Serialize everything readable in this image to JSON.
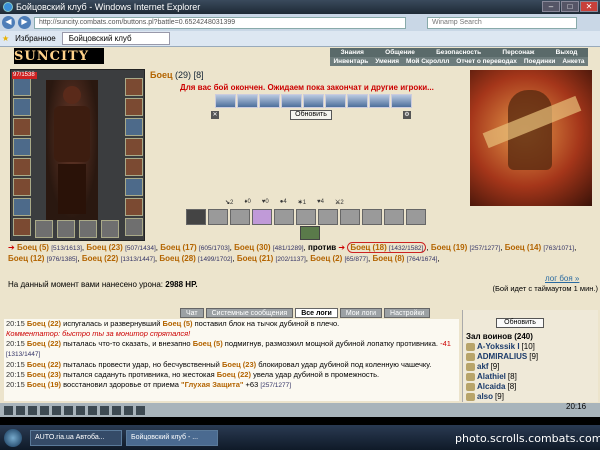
{
  "window": {
    "title": "Бойцовский клуб - Windows Internet Explorer"
  },
  "address": {
    "url": "http://suncity.combats.com/buttons.pl?battle=0.6524248031399",
    "search_placeholder": "Winamp Search"
  },
  "favorites": {
    "label": "Избранное",
    "tab": "Бойцовский клуб"
  },
  "site": {
    "logo": "SUNCITY"
  },
  "menu": {
    "row1": [
      "Знания",
      "Общение",
      "Безопасность",
      "Персонаж",
      "Выход"
    ],
    "row2": [
      "Инвентарь",
      "Умения",
      "Мой Скроллл",
      "Отчет о переводах",
      "Поединки",
      "Анкета"
    ]
  },
  "char": {
    "hp": "97/1538",
    "title_name": "Боец",
    "title_level": "(29)",
    "title_id": "[8]"
  },
  "battle": {
    "wait_msg": "Для вас бой окончен. Ожидаем пока закончат и другие игроки...",
    "refresh": "Обновить"
  },
  "stats": [
    "2",
    "0",
    "0",
    "4",
    "1",
    "4",
    "2"
  ],
  "fight": {
    "line1": [
      {
        "n": "Боец (5)",
        "s": "[513/1613]"
      },
      {
        "n": "Боец (23)",
        "s": "[507/1434]"
      },
      {
        "n": "Боец (17)",
        "s": "[605/1703]"
      },
      {
        "n": "Боец (30)",
        "s": "[481/1289]"
      }
    ],
    "vs": "против",
    "right": [
      {
        "n": "Боец (18)",
        "s": "[1432/1582]"
      },
      {
        "n": "Боец (19)",
        "s": "[257/1277]"
      },
      {
        "n": "Боец (14)",
        "s": "[763/1071]"
      },
      {
        "n": "Боец (12)",
        "s": "[976/1385]"
      },
      {
        "n": "Боец (22)",
        "s": "[1313/1447]"
      },
      {
        "n": "Боец (28)",
        "s": "[1499/1702]"
      },
      {
        "n": "Боец (21)",
        "s": "[202/1137]"
      },
      {
        "n": "Боец (2)",
        "s": "[65/877]"
      },
      {
        "n": "Боец (8)",
        "s": "[764/1674]"
      }
    ],
    "damage_label": "На данный момент вами нанесено урона:",
    "damage_value": "2988 HP.",
    "log": "лог боя »",
    "timeout": "(Бой идет с таймаутом 1 мин.)"
  },
  "tabs": [
    "Чат",
    "Системные сообщения",
    "Все логи",
    "Мои логи",
    "Настройки"
  ],
  "chat": [
    {
      "t": "20:15",
      "a": "Боец (22)",
      "m": "испугалась и развернувший",
      "b": "Боец (5)",
      "r": "поставил блок на тычок дубиной в плечо."
    },
    {
      "c": "Комментатор: быстро ты за монитор спрятался!"
    },
    {
      "t": "20:15",
      "a": "Боец (22)",
      "m": "пыталась что-то сказать, и внезапно",
      "b": "Боец (5)",
      "r": "подмигнув, размозжил мощной дубиной лопатку противника.",
      "v": "-41",
      "s": "[1313/1447]"
    },
    {
      "t": "20:15",
      "a": "Боец (22)",
      "m": "пыталась провести удар, но бесчувственный",
      "b": "Боец (23)",
      "r": "блокировал удар дубиной под коленную чашечку."
    },
    {
      "t": "20:15",
      "a": "Боец (23)",
      "m": "пытался садануть противника, но жестокая",
      "b": "Боец (22)",
      "r": "увела удар дубиной в промежность."
    },
    {
      "t": "20:15",
      "a": "Боец (19)",
      "m": "восстановил здоровье от приема",
      "b": "\"Глухая Защита\"",
      "r": "+63",
      "s": "[257/1277]"
    }
  ],
  "hall": {
    "refresh": "Обновить",
    "title": "Зал воинов (240)",
    "players": [
      {
        "n": "A-Yokssik I",
        "l": "[10]"
      },
      {
        "n": "ADMIRALIUS",
        "l": "[9]"
      },
      {
        "n": "akf",
        "l": "[9]"
      },
      {
        "n": "Alathiel",
        "l": "[8]"
      },
      {
        "n": "Alcaida",
        "l": "[8]"
      },
      {
        "n": "also",
        "l": "[9]"
      }
    ]
  },
  "clock": "20:16",
  "taskbar": [
    "AUTO.ria.ua Автоба...",
    "Бойцовский клуб - ..."
  ],
  "watermark": "photo.scrolls.combats.com"
}
